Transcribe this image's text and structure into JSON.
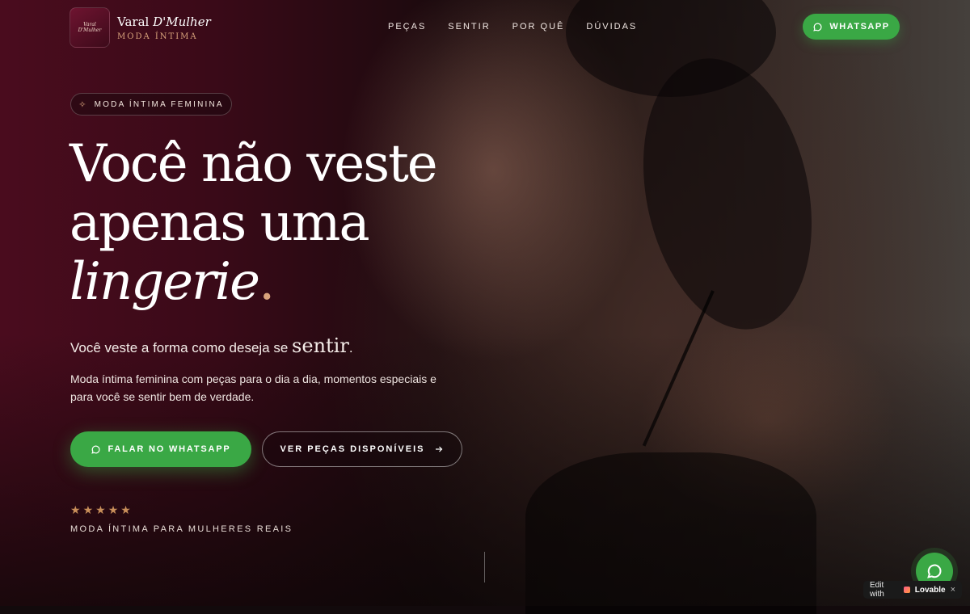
{
  "brand": {
    "logo_mark_line1": "Varal",
    "logo_mark_line2": "D'Mulher",
    "name_prefix": "Varal ",
    "name_italic": "D'Mulher",
    "subtitle": "MODA ÍNTIMA"
  },
  "nav": {
    "items": [
      {
        "label": "PEÇAS"
      },
      {
        "label": "SENTIR"
      },
      {
        "label": "POR QUÊ"
      },
      {
        "label": "DÚVIDAS"
      }
    ]
  },
  "header": {
    "whatsapp_label": "WHATSAPP",
    "whatsapp_icon": "whatsapp-icon"
  },
  "hero": {
    "badge_icon": "sparkle-icon",
    "badge": "MODA ÍNTIMA FEMININA",
    "headline_line1": "Você não veste",
    "headline_line2": "apenas uma",
    "headline_italic": "lingerie",
    "headline_period": ".",
    "subheadline_prefix": "Você veste a forma como deseja se ",
    "subheadline_accent": "sentir",
    "subheadline_suffix": ".",
    "description": "Moda íntima feminina com peças para o dia a dia, momentos especiais e para você se sentir bem de verdade.",
    "cta_whatsapp": "FALAR NO WHATSAPP",
    "cta_pieces": "VER PEÇAS DISPONÍVEIS",
    "cta_pieces_icon": "arrow-right-icon",
    "rating": {
      "stars": 5,
      "max": 5
    },
    "tagline": "MODA ÍNTIMA PARA MULHERES REAIS"
  },
  "floating": {
    "whatsapp_icon": "whatsapp-icon"
  },
  "lovable_badge": {
    "prefix": "Edit with",
    "brand": "Lovable",
    "close": "×"
  },
  "colors": {
    "accent_green": "#3aa845",
    "accent_gold": "#d9a37c",
    "brand_wine": "#4a0c1e"
  }
}
